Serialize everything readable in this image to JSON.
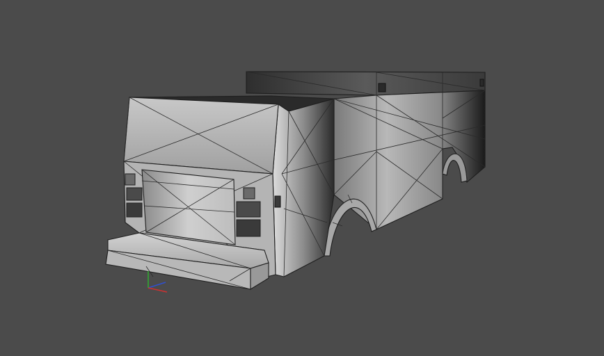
{
  "viewport": {
    "background": "#4b4b4b",
    "content": "3d-truck-body-wireframe-model"
  },
  "axis_gizmo": {
    "x_color": "#d03030",
    "y_color": "#30b030",
    "z_color": "#3050d0"
  }
}
